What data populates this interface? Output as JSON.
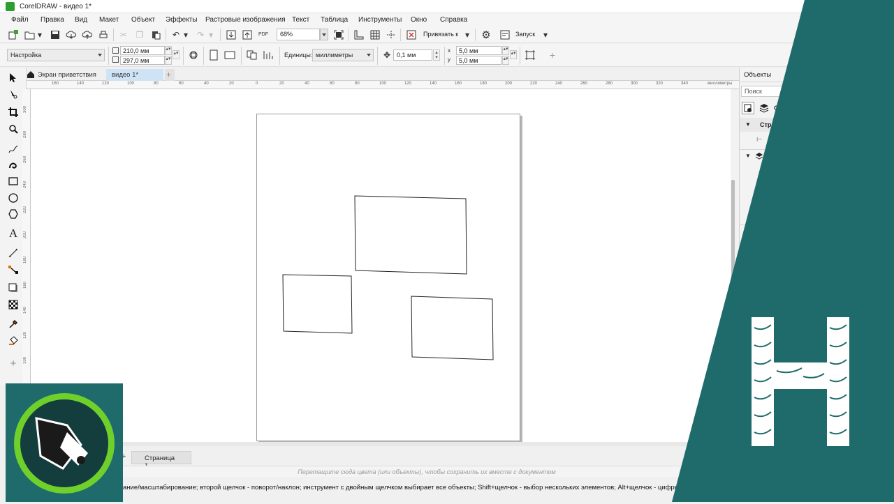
{
  "app": {
    "title": "CorelDRAW - видео 1*"
  },
  "menu": [
    "Файл",
    "Правка",
    "Вид",
    "Макет",
    "Объект",
    "Эффекты",
    "Растровые изображения",
    "Текст",
    "Таблица",
    "Инструменты",
    "Окно",
    "Справка"
  ],
  "toolbar": {
    "zoom_value": "68%",
    "snap_label": "Привязать к",
    "launch_label": "Запуск",
    "pdf_label": "PDF"
  },
  "propbar": {
    "preset": "Настройка",
    "width": "210,0 мм",
    "height": "297,0 мм",
    "units_label": "Единицы:",
    "units_value": "миллиметры",
    "nudge": "0,1 мм",
    "dup_x": "5,0 мм",
    "dup_y": "5,0 мм",
    "dup_x_label": "x",
    "dup_y_label": "y"
  },
  "tabs": {
    "welcome": "Экран приветствия",
    "doc": "видео 1*",
    "add": "+"
  },
  "ruler": {
    "h_ticks": [
      "160",
      "140",
      "120",
      "100",
      "80",
      "60",
      "40",
      "20",
      "0",
      "20",
      "40",
      "60",
      "80",
      "100",
      "120",
      "140",
      "160",
      "180",
      "200",
      "220",
      "240",
      "260",
      "280",
      "300",
      "320",
      "340"
    ],
    "h_unit": "миллиметры",
    "v_ticks": [
      "300",
      "280",
      "260",
      "240",
      "220",
      "200",
      "180",
      "160",
      "140",
      "120",
      "100"
    ]
  },
  "page_nav": {
    "add": "+",
    "page_tab": "Страница 1"
  },
  "color_hint": "Перетащите сюда цвета (или объекты), чтобы сохранить их вместе с документом",
  "status": "ание/масштабирование; второй щелчок - поворот/наклон; инструмент с двойным щелчком выбирает все объекты; Shift+щелчок - выбор нескольких элементов; Alt+щелчок - цифры",
  "objects_panel": {
    "title": "Объекты",
    "search_placeholder": "Поиск",
    "row_page": "Стра",
    "col_o": "О"
  },
  "colors": {
    "teal": "#1f6b6b",
    "green": "#6fd02b",
    "accent_tab": "#cfe3f7"
  }
}
